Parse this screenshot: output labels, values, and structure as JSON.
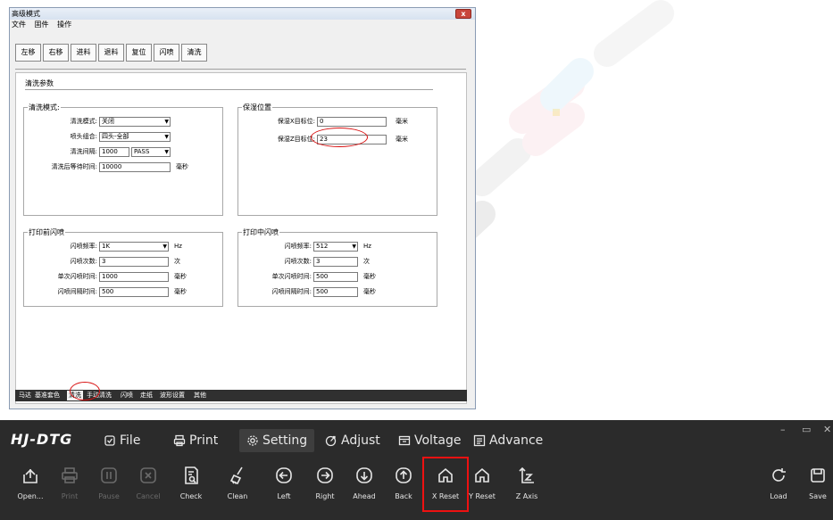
{
  "dialog": {
    "title": "高级模式",
    "close": "x",
    "menu": [
      "文件",
      "固件",
      "操作"
    ],
    "toolbar": [
      "左移",
      "右移",
      "进料",
      "退料",
      "复位",
      "闪喷",
      "清洗"
    ],
    "panel_title": "清洗参数",
    "clean_group": {
      "label": "清洗模式:",
      "mode_label": "清洗模式:",
      "mode_value": "关闭",
      "nozzle_label": "喷头组合:",
      "nozzle_value": "四头-全部",
      "interval_label": "清洗间隔:",
      "interval_value": "1000",
      "interval_unit": "PASS",
      "wait_label": "清洗后等待时间:",
      "wait_value": "10000",
      "wait_unit": "毫秒"
    },
    "moist_group": {
      "label": "保湿位置",
      "x_label": "保湿X目标位:",
      "x_value": "0",
      "x_unit": "毫米",
      "z_label": "保湿Z目标位:",
      "z_value": "23",
      "z_unit": "毫米"
    },
    "pre_flash": {
      "label": "打印前闪喷",
      "freq_label": "闪喷频率:",
      "freq_value": "1K",
      "freq_unit": "Hz",
      "count_label": "闪喷次数:",
      "count_value": "3",
      "count_unit": "次",
      "single_label": "单次闪喷时间:",
      "single_value": "1000",
      "single_unit": "毫秒",
      "gap_label": "闪喷间隔时间:",
      "gap_value": "500",
      "gap_unit": "毫秒"
    },
    "mid_flash": {
      "label": "打印中闪喷",
      "freq_label": "闪喷频率:",
      "freq_value": "512",
      "freq_unit": "Hz",
      "count_label": "闪喷次数:",
      "count_value": "3",
      "count_unit": "次",
      "single_label": "单次闪喷时间:",
      "single_value": "500",
      "single_unit": "毫秒",
      "gap_label": "闪喷间隔时间:",
      "gap_value": "500",
      "gap_unit": "毫秒"
    },
    "tabs": [
      "马达",
      "基准套色",
      "清洗",
      "手动清洗",
      "闪喷",
      "走纸",
      "波形设置",
      "其他"
    ]
  },
  "app": {
    "brand": "HJ-DTG",
    "menu": [
      "File",
      "Print",
      "Setting",
      "Adjust",
      "Voltage",
      "Advance"
    ],
    "active_menu": "Setting",
    "window_controls": [
      "–",
      "▭",
      "✕"
    ],
    "tools": [
      "Open...",
      "Print",
      "Pause",
      "Cancel",
      "Check",
      "Clean",
      "Left",
      "Right",
      "Ahead",
      "Back",
      "X Reset",
      "Y Reset",
      "Z Axis"
    ],
    "right_tools": [
      "Load",
      "Save"
    ],
    "highlighted_tool": "X Reset"
  },
  "colors": {
    "appbar_bg": "#2b2b2b",
    "highlight": "#e11111",
    "annotation": "#d81010"
  }
}
